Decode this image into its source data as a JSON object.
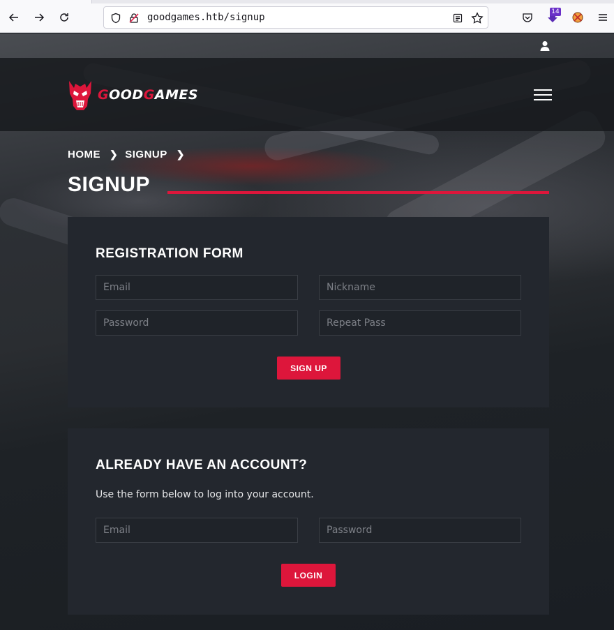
{
  "browser": {
    "url": "goodgames.htb/signup",
    "extension_badge": "14",
    "icons": [
      "back-arrow-icon",
      "forward-arrow-icon",
      "reload-icon",
      "shield-icon",
      "insecure-lock-icon",
      "reader-view-icon",
      "bookmark-star-icon",
      "pocket-icon",
      "download-icon",
      "extension-icon",
      "menu-icon"
    ]
  },
  "header": {
    "logo_text_g1": "G",
    "logo_text_mid": "OOD",
    "logo_text_g2": "G",
    "logo_text_end": "AMES"
  },
  "breadcrumb": {
    "items": [
      "HOME",
      "SIGNUP"
    ]
  },
  "page_title": "SIGNUP",
  "registration": {
    "heading": "REGISTRATION FORM",
    "email_placeholder": "Email",
    "nickname_placeholder": "Nickname",
    "password_placeholder": "Password",
    "repeat_placeholder": "Repeat Pass",
    "submit_label": "SIGN UP"
  },
  "login": {
    "heading": "ALREADY HAVE AN ACCOUNT?",
    "description": "Use the form below to log into your account.",
    "email_placeholder": "Email",
    "password_placeholder": "Password",
    "submit_label": "LOGIN"
  },
  "colors": {
    "accent": "#dd163b",
    "panel": "#23272e",
    "navbar": "#16181c"
  }
}
